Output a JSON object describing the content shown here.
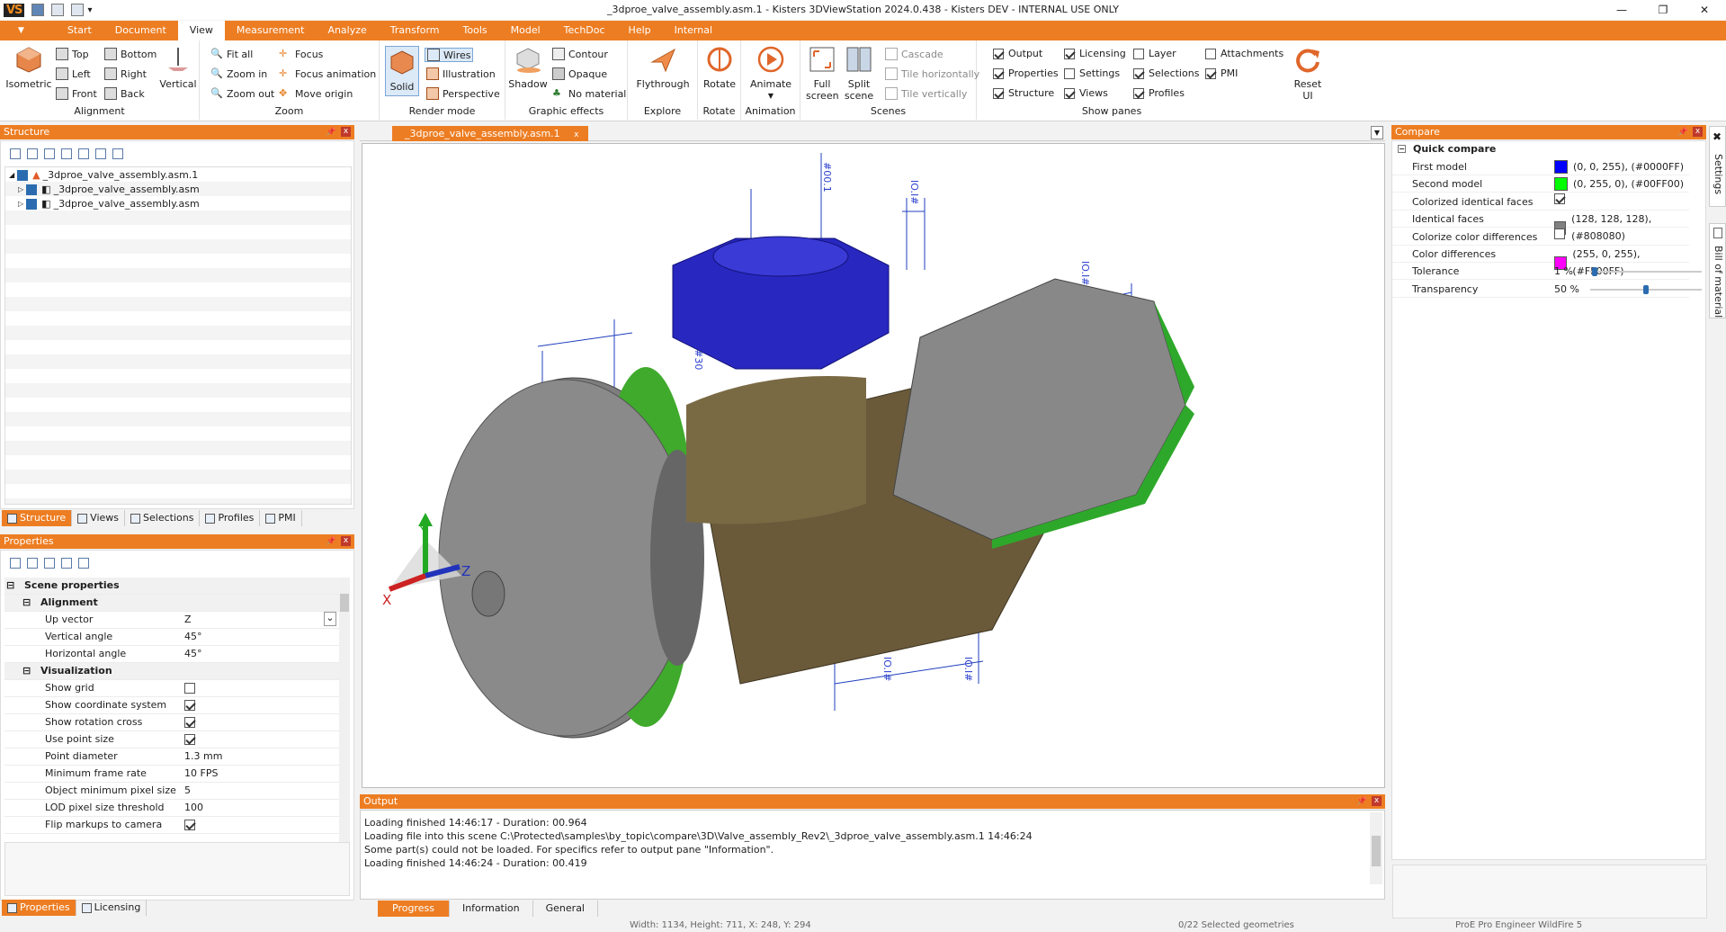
{
  "titlebar": {
    "logo": "VS",
    "title": "_3dproe_valve_assembly.asm.1 - Kisters 3DViewStation 2024.0.438 - Kisters DEV - INTERNAL USE ONLY",
    "minimize": "—",
    "maximize": "❐",
    "close": "✕"
  },
  "menu": {
    "dropdown": "▼",
    "items": [
      "Start",
      "Document",
      "View",
      "Measurement",
      "Analyze",
      "Transform",
      "Tools",
      "Model",
      "TechDoc",
      "Help",
      "Internal"
    ]
  },
  "ribbon": {
    "alignment": {
      "label": "Alignment",
      "isometric": "Isometric",
      "top": "Top",
      "left": "Left",
      "front": "Front",
      "bottom": "Bottom",
      "right": "Right",
      "back": "Back",
      "vertical": "Vertical"
    },
    "zoom": {
      "label": "Zoom",
      "fit_all": "Fit all",
      "zoom_in": "Zoom in",
      "zoom_out": "Zoom out",
      "focus": "Focus",
      "focus_animation": "Focus animation",
      "move_origin": "Move origin"
    },
    "render": {
      "label": "Render mode",
      "solid": "Solid",
      "wires": "Wires",
      "illustration": "Illustration",
      "perspective": "Perspective"
    },
    "graphic": {
      "label": "Graphic effects",
      "shadow": "Shadow",
      "contour": "Contour",
      "opaque": "Opaque",
      "no_material": "No material"
    },
    "explore": {
      "label": "Explore",
      "flythrough": "Flythrough"
    },
    "rotate": {
      "label": "Rotate",
      "rotate": "Rotate"
    },
    "animation": {
      "label": "Animation",
      "animate": "Animate"
    },
    "scenes": {
      "label": "Scenes",
      "full_screen": "Full screen",
      "split_scene": "Split scene",
      "cascade": "Cascade",
      "tile_h": "Tile horizontally",
      "tile_v": "Tile vertically"
    },
    "panes": {
      "label": "Show panes",
      "output": "Output",
      "properties": "Properties",
      "structure": "Structure",
      "licensing": "Licensing",
      "settings": "Settings",
      "views": "Views",
      "layer": "Layer",
      "selections": "Selections",
      "profiles": "Profiles",
      "attachments": "Attachments",
      "pmi": "PMI",
      "reset_ui": "Reset UI"
    }
  },
  "structure": {
    "title": "Structure",
    "items": [
      "_3dproe_valve_assembly.asm.1",
      "_3dproe_valve_assembly.asm",
      "_3dproe_valve_assembly.asm"
    ],
    "tabs": [
      "Structure",
      "Views",
      "Selections",
      "Profiles",
      "PMI"
    ]
  },
  "properties": {
    "title": "Properties",
    "rows": [
      {
        "k": "Scene properties",
        "v": "",
        "sec": true,
        "lvl": 0
      },
      {
        "k": "Alignment",
        "v": "",
        "sec": true,
        "lvl": 1
      },
      {
        "k": "Up vector",
        "v": "Z"
      },
      {
        "k": "Vertical angle",
        "v": "45°"
      },
      {
        "k": "Horizontal angle",
        "v": "45°"
      },
      {
        "k": "Visualization",
        "v": "",
        "sec": true,
        "lvl": 1
      },
      {
        "k": "Show grid",
        "v": "",
        "chk": false
      },
      {
        "k": "Show coordinate system",
        "v": "",
        "chk": true
      },
      {
        "k": "Show rotation cross",
        "v": "",
        "chk": true
      },
      {
        "k": "Use point size",
        "v": "",
        "chk": true
      },
      {
        "k": "Point diameter",
        "v": "1.3 mm"
      },
      {
        "k": "Minimum frame rate",
        "v": "10 FPS"
      },
      {
        "k": "Object minimum pixel size",
        "v": "5"
      },
      {
        "k": "LOD pixel size threshold",
        "v": "100"
      },
      {
        "k": "Flip markups to camera",
        "v": "",
        "chk": true
      }
    ],
    "tabs": [
      "Properties",
      "Licensing"
    ]
  },
  "viewer": {
    "tab": "_3dproe_valve_assembly.asm.1",
    "axes": {
      "x": "X",
      "y": "Y",
      "z": "Z"
    }
  },
  "output": {
    "title": "Output",
    "lines": [
      "Loading finished 14:46:17 - Duration: 00.964",
      "Loading file into this scene C:\\Protected\\samples\\by_topic\\compare\\3D\\Valve_assembly_Rev2\\_3dproe_valve_assembly.asm.1 14:46:24",
      "Some part(s) could not be loaded. For specifics refer to output pane \"Information\".",
      "Loading finished 14:46:24 - Duration: 00.419"
    ],
    "tabs": [
      "Progress",
      "Information",
      "General"
    ]
  },
  "compare": {
    "title": "Compare",
    "section": "Quick compare",
    "rows": [
      {
        "k": "First model",
        "v": "(0, 0, 255), (#0000FF)",
        "color": "#0000FF"
      },
      {
        "k": "Second model",
        "v": "(0, 255, 0), (#00FF00)",
        "color": "#00FF00"
      },
      {
        "k": "Colorized identical faces",
        "v": "",
        "chk": true
      },
      {
        "k": "Identical faces",
        "v": "(128, 128, 128), (#808080)",
        "color": "#808080"
      },
      {
        "k": "Colorize color differences",
        "v": "",
        "chk": false
      },
      {
        "k": "Color differences",
        "v": "(255, 0, 255), (#FF00FF)",
        "color": "#FF00FF"
      },
      {
        "k": "Tolerance",
        "v": "1 %",
        "slider": 0.02
      },
      {
        "k": "Transparency",
        "v": "50 %",
        "slider": 0.5
      }
    ]
  },
  "side_tabs": [
    "Settings",
    "Bill of material"
  ],
  "status": {
    "size": "Width: 1134, Height: 711, X: 248, Y: 294",
    "selected": "0/22 Selected geometries",
    "format": "ProE Pro Engineer WildFire 5"
  }
}
